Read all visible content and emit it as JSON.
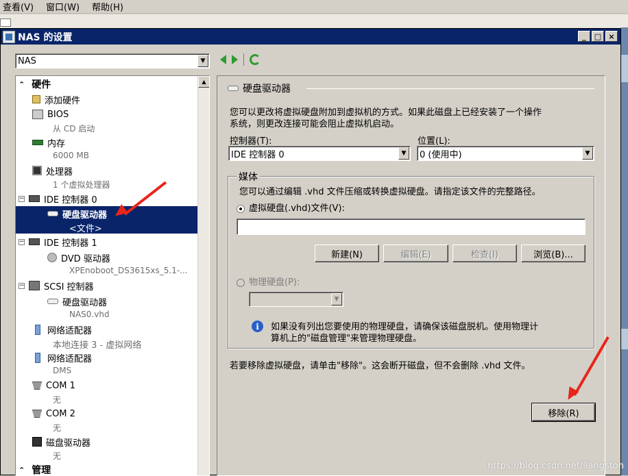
{
  "menubar": {
    "items": [
      "查看(V)",
      "窗口(W)",
      "帮助(H)"
    ]
  },
  "window": {
    "title": "NAS 的设置",
    "min": "_",
    "max": "□",
    "close": "×"
  },
  "vm_select": {
    "value": "NAS"
  },
  "tree": {
    "hardware_header": "硬件",
    "items": [
      {
        "label": "添加硬件",
        "sub": ""
      },
      {
        "label": "BIOS",
        "sub": "从 CD 启动"
      },
      {
        "label": "内存",
        "sub": "6000 MB"
      },
      {
        "label": "处理器",
        "sub": "1 个虚拟处理器"
      },
      {
        "label": "IDE 控制器 0",
        "sub": ""
      },
      {
        "label": "硬盘驱动器",
        "sub": "<文件>"
      },
      {
        "label": "IDE 控制器 1",
        "sub": ""
      },
      {
        "label": "DVD 驱动器",
        "sub": "XPEnoboot_DS3615xs_5.1-..."
      },
      {
        "label": "SCSI 控制器",
        "sub": ""
      },
      {
        "label": "硬盘驱动器",
        "sub": "NAS0.vhd"
      },
      {
        "label": "网络适配器",
        "sub": "本地连接 3 - 虚拟网络"
      },
      {
        "label": "网络适配器",
        "sub": "DMS"
      },
      {
        "label": "COM 1",
        "sub": "无"
      },
      {
        "label": "COM 2",
        "sub": "无"
      },
      {
        "label": "磁盘驱动器",
        "sub": "无"
      }
    ],
    "management_header": "管理",
    "expander_minus": "−",
    "chev_up": "⌃"
  },
  "panel": {
    "title": "硬盘驱动器",
    "desc_line1": "您可以更改将虚拟硬盘附加到虚拟机的方式。如果此磁盘上已经安装了一个操作",
    "desc_line2": "系统，则更改连接可能会阻止虚拟机启动。",
    "controller_label": "控制器(T):",
    "controller_value": "IDE 控制器 0",
    "location_label": "位置(L):",
    "location_value": "0 (使用中)",
    "media_label": "媒体",
    "media_desc": "您可以通过编辑 .vhd 文件压缩或转换虚拟硬盘。请指定该文件的完整路径。",
    "vhd_radio": "虚拟硬盘(.vhd)文件(V):",
    "vhd_path": "",
    "btn_new": "新建(N)",
    "btn_edit": "编辑(E)",
    "btn_inspect": "检查(I)",
    "btn_browse": "浏览(B)...",
    "physical_radio": "物理硬盘(P):",
    "physical_value": "",
    "info_line1": "如果没有列出您要使用的物理硬盘，请确保该磁盘脱机。使用物理计",
    "info_line2": "算机上的\"磁盘管理\"来管理物理硬盘。",
    "remove_desc": "若要移除虚拟硬盘，请单击\"移除\"。这会断开磁盘，但不会删除 .vhd 文件。",
    "btn_remove": "移除(R)"
  },
  "watermark": "https://blog.csdn.net/liangston",
  "colors": {
    "titlebar": "#0a246a",
    "selection": "#0a246a",
    "annotation_arrow": "#e8251a",
    "nav_green": "#2f9b2f"
  }
}
